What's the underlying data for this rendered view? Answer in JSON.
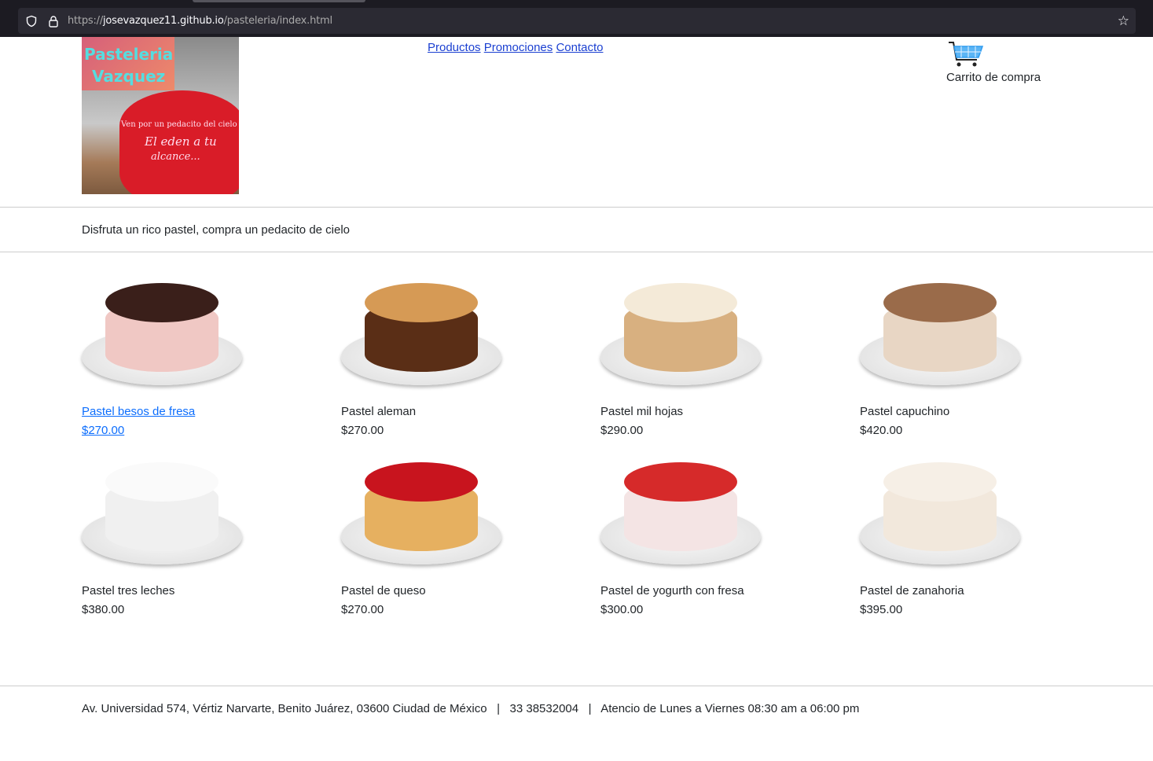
{
  "browser": {
    "url_domain_prefix": "https://",
    "url_domain": "josevazquez11.github.io",
    "url_path": "/pasteleria/index.html"
  },
  "logo": {
    "line1": "Pasteleria",
    "line2": "Vazquez",
    "line3": "Ven por un pedacito del cielo",
    "line4": "El eden a tu",
    "line5": "alcance..."
  },
  "nav": {
    "items": [
      "Productos",
      "Promociones",
      "Contacto"
    ]
  },
  "cart": {
    "label": "Carrito de compra",
    "icon": "shopping-cart-icon",
    "color": "#2e9bf0"
  },
  "tagline": "Disfruta un rico pastel, compra un pedacito de cielo",
  "products": [
    {
      "name": "Pastel besos de fresa",
      "price": "$270.00",
      "top": "#3a1f1a",
      "side": "#f0c8c4"
    },
    {
      "name": "Pastel aleman",
      "price": "$270.00",
      "top": "#d69a55",
      "side": "#5a2e16"
    },
    {
      "name": "Pastel mil hojas",
      "price": "$290.00",
      "top": "#f4ead8",
      "side": "#d8b080"
    },
    {
      "name": "Pastel capuchino",
      "price": "$420.00",
      "top": "#9a6b4a",
      "side": "#e8d6c4"
    },
    {
      "name": "Pastel tres leches",
      "price": "$380.00",
      "top": "#fafafa",
      "side": "#f0f0f0"
    },
    {
      "name": "Pastel de queso",
      "price": "$270.00",
      "top": "#c8141e",
      "side": "#e6b060"
    },
    {
      "name": "Pastel de yogurth con fresa",
      "price": "$300.00",
      "top": "#d62a2a",
      "side": "#f4e4e4"
    },
    {
      "name": "Pastel de zanahoria",
      "price": "$395.00",
      "top": "#f6efe6",
      "side": "#f2e8dc"
    }
  ],
  "footer": {
    "address": "Av. Universidad 574, Vértiz Narvarte, Benito Juárez, 03600 Ciudad de México",
    "sep": "|",
    "phone": "33 38532004",
    "hours": "Atencio de Lunes a Viernes 08:30 am a 06:00 pm"
  }
}
